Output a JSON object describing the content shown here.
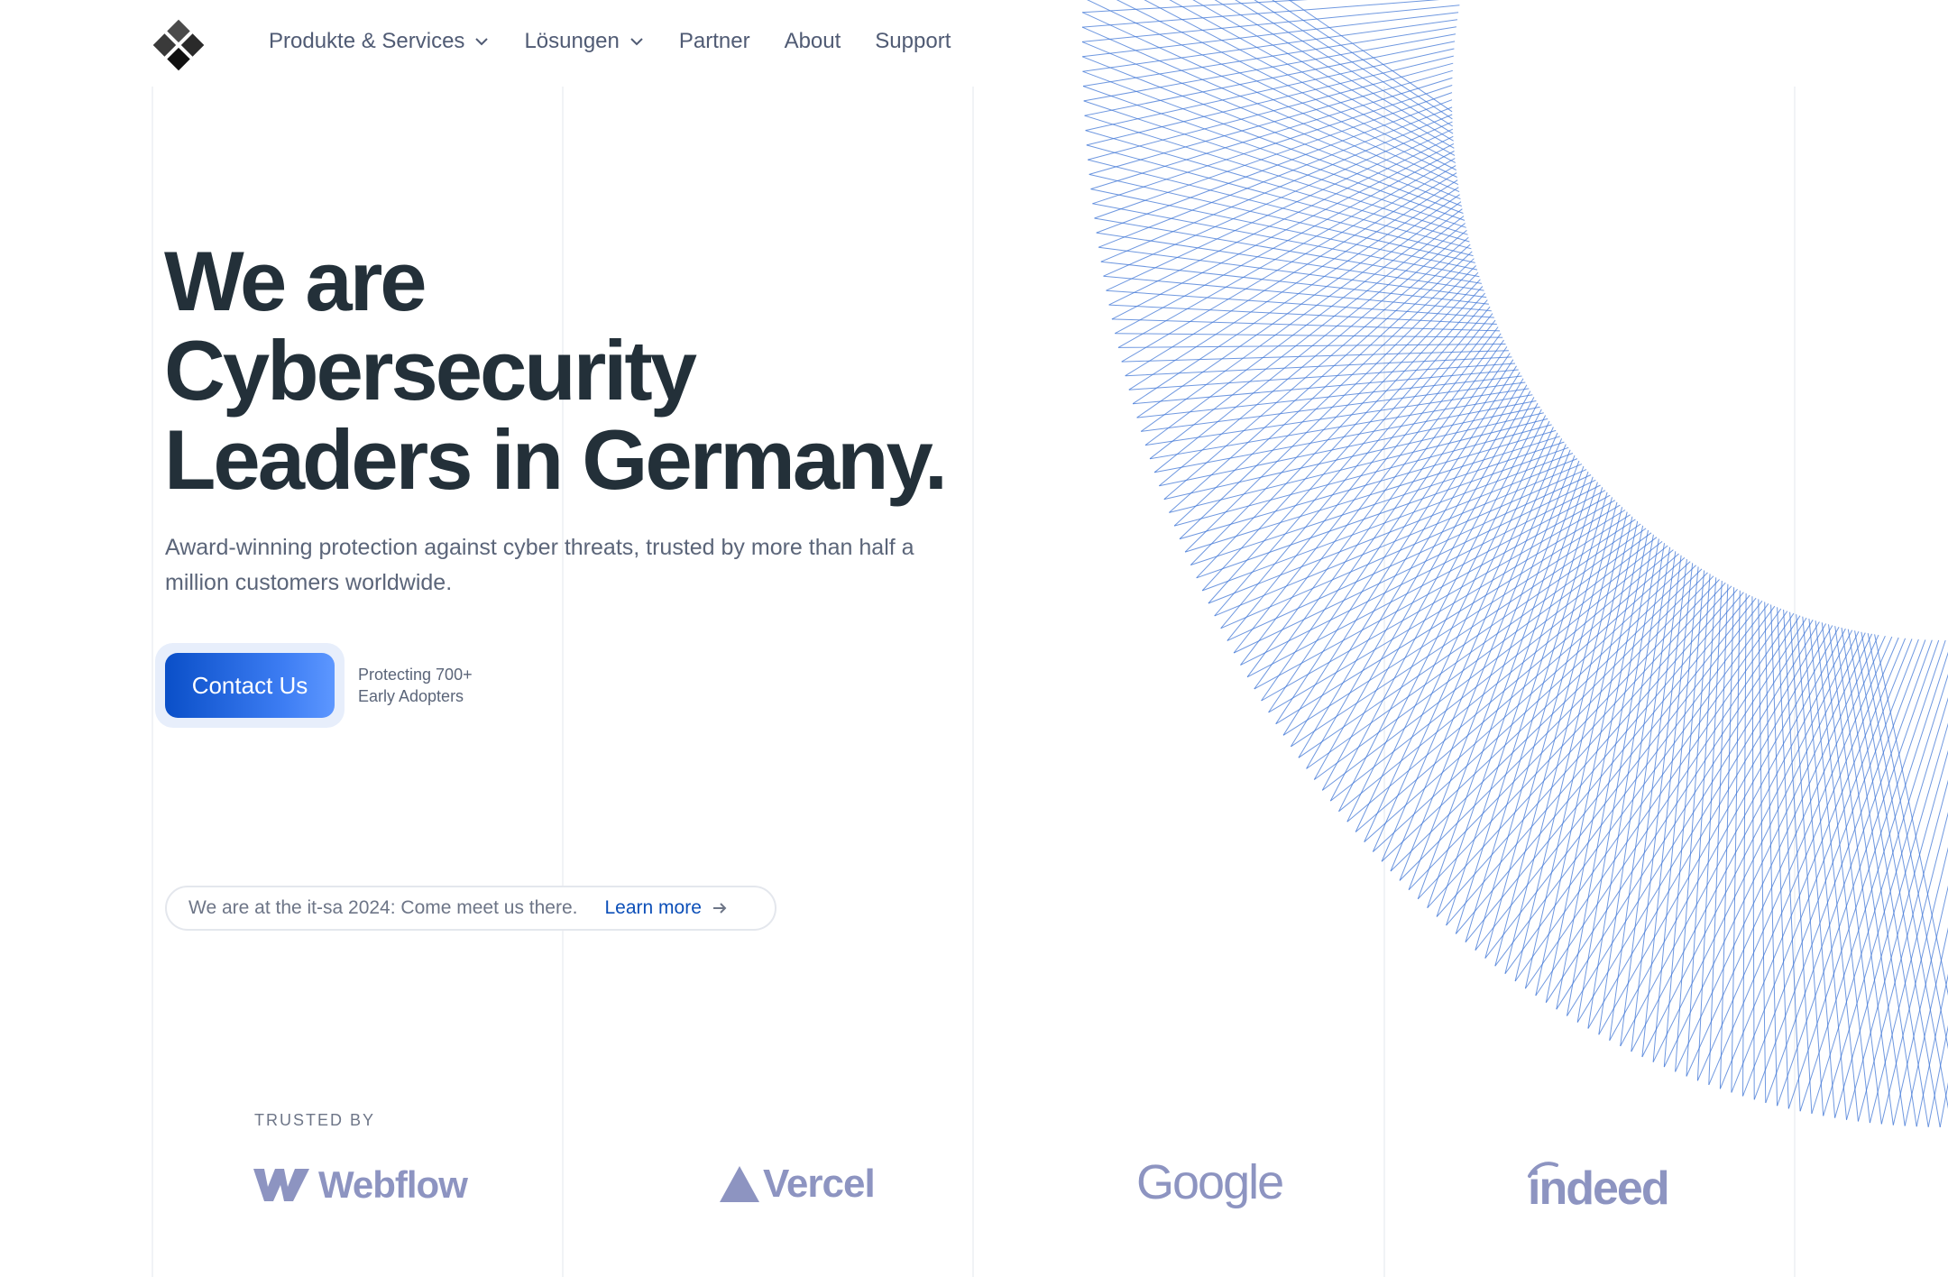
{
  "header": {
    "nav": [
      {
        "label": "Produkte & Services",
        "has_dropdown": true
      },
      {
        "label": "Lösungen",
        "has_dropdown": true
      },
      {
        "label": "Partner",
        "has_dropdown": false
      },
      {
        "label": "About",
        "has_dropdown": false
      },
      {
        "label": "Support",
        "has_dropdown": false
      }
    ]
  },
  "hero": {
    "title_lines": [
      "We are",
      "Cybersecurity",
      "Leaders in Germany."
    ],
    "subtitle": "Award-winning protection against cyber threats, trusted by more than half a million customers worldwide.",
    "cta_label": "Contact Us",
    "adopters_lines": [
      "Protecting 700+",
      "Early Adopters"
    ]
  },
  "announcement": {
    "text": "We are at the it-sa 2024: Come meet us there.",
    "link_label": "Learn more"
  },
  "trusted": {
    "heading": "TRUSTED BY",
    "brands": [
      "Webflow",
      "Vercel",
      "Google",
      "indeed"
    ]
  },
  "colors": {
    "primary": "#0a4fc8",
    "heading": "#233039",
    "body_text": "#5b6579",
    "brand_logo": "#8d94c1",
    "mesh_line": "#3f76d6"
  },
  "icons": [
    "logo-diamond-icon",
    "chevron-down-icon",
    "arrow-right-icon",
    "webflow-logo-icon",
    "vercel-triangle-icon",
    "indeed-arc-icon"
  ]
}
